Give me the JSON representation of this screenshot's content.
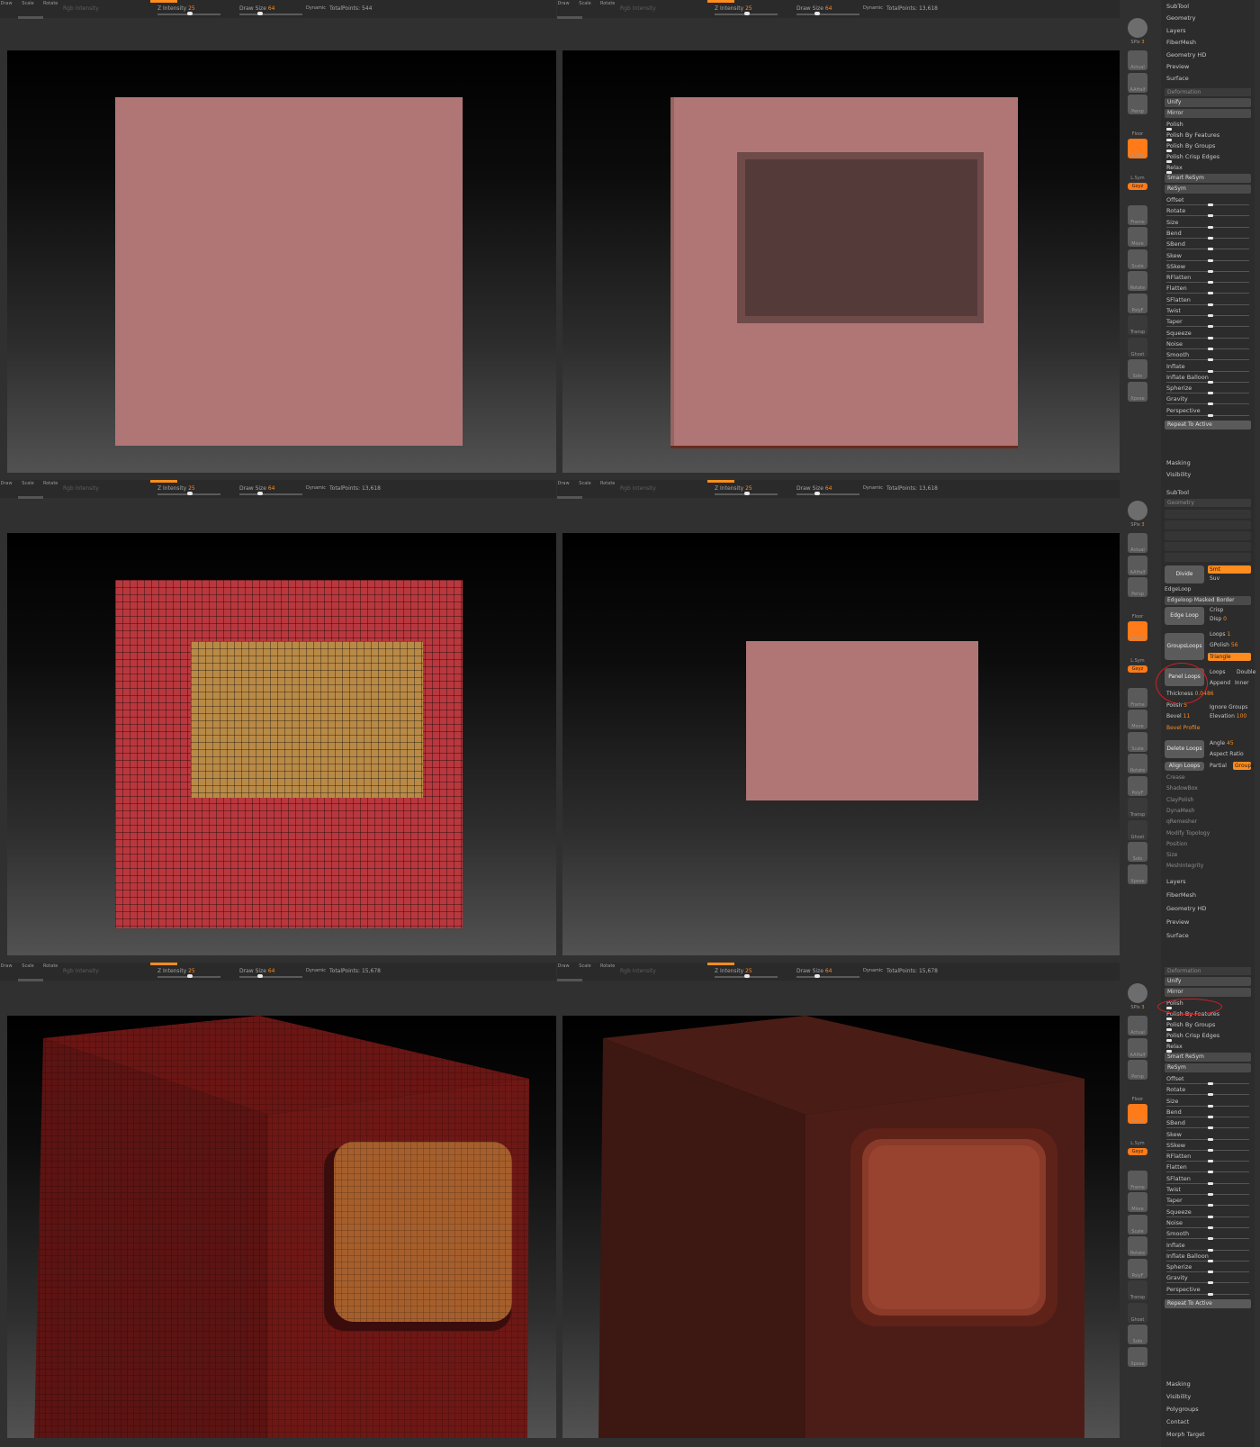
{
  "colors": {
    "accent": "#ff8c1e",
    "mesh_pink": "#b07675",
    "polygroup_red": "#b8383e",
    "polygroup_yellow": "#b98a46"
  },
  "topbar": {
    "mode_labels": [
      "Draw",
      "Scale",
      "Rotate"
    ],
    "rgb_intensity": "Rgb Intensity",
    "z_intensity_label": "Z Intensity",
    "z_intensity_value": "25",
    "draw_size_label": "Draw Size",
    "draw_size_value": "64",
    "dynamic": "Dynamic",
    "total_points_label": "TotalPoints:",
    "total_points_values": [
      "544",
      "13,618",
      "13,618",
      "13,618",
      "15,678",
      "15,678"
    ]
  },
  "shelf": {
    "labels": [
      "SPix",
      "Actual",
      "AAHalf",
      "Persp",
      "Floor",
      "Local",
      "L.Sym",
      "Gxyz",
      "Frame",
      "Move",
      "Scale",
      "Rotate",
      "PolyF",
      "Transp",
      "Ghost",
      "Solo",
      "Xpose"
    ],
    "spix_value": "3"
  },
  "panel_top": {
    "menu": [
      "SubTool",
      "Geometry",
      "Layers",
      "FiberMesh",
      "Geometry HD",
      "Preview",
      "Surface"
    ],
    "header": "Deformation",
    "toggles": [
      "Unify",
      "Mirror"
    ],
    "polish_items": [
      "Polish",
      "Polish By Features",
      "Polish By Groups",
      "Polish Crisp Edges",
      "Relax"
    ],
    "toggles2": [
      "Smart ReSym",
      "ReSym"
    ],
    "sliders": [
      "Offset",
      "Rotate",
      "Size",
      "Bend",
      "SBend",
      "Skew",
      "SSkew",
      "RFlatten",
      "Flatten",
      "SFlatten",
      "Twist",
      "Taper",
      "Squeeze",
      "Noise",
      "Smooth",
      "Inflate",
      "Inflate Balloon",
      "Spherize",
      "Gravity",
      "Perspective"
    ],
    "repeat": "Repeat To Active",
    "footer": [
      "Masking",
      "Visibility"
    ]
  },
  "panel_mid": {
    "subtool": "SubTool",
    "geometry": "Geometry",
    "divide": "Divide",
    "smt": "Smt",
    "suv": "Suv",
    "edgeloop_head": "EdgeLoop",
    "edgeloop_masked": "Edgeloop Masked Border",
    "edge_loop": "Edge Loop",
    "crisp": "Crisp",
    "disp": "Disp",
    "disp_value": "0",
    "groups_loops": "GroupsLoops",
    "loops_label": "Loops",
    "loops_value": "1",
    "gpolish": "GPolish",
    "gpolish_value": "56",
    "triangle": "Triangle",
    "panel_loops": "Panel Loops",
    "loops2": "Loops",
    "double": "Double",
    "append": "Append",
    "inner": "Inner",
    "thickness": "Thickness",
    "thickness_value": "0.0486",
    "polish_label": "Polish",
    "polish_value": "5",
    "ignore_groups": "Ignore Groups",
    "bevel": "Bevel",
    "bevel_value": "11",
    "elevation": "Elevation",
    "elevation_value": "100",
    "bevel_profile": "Bevel Profile",
    "delete_loops": "Delete Loops",
    "angle": "Angle",
    "angle_value": "45",
    "aspect_ratio": "Aspect Ratio",
    "align_loops": "Align Loops",
    "partial": "Partial",
    "groups": "Groups",
    "menu": [
      "Crease",
      "ShadowBox",
      "ClayPolish",
      "DynaMesh",
      "qRemesher",
      "Modify Topology",
      "Position",
      "Size",
      "MeshIntegrity"
    ],
    "below": [
      "Layers",
      "FiberMesh",
      "Geometry HD",
      "Preview",
      "Surface"
    ]
  },
  "panel_bot": {
    "header": "Deformation",
    "footer": [
      "Masking",
      "Visibility",
      "Polygroups",
      "Contact",
      "Morph Target"
    ]
  }
}
